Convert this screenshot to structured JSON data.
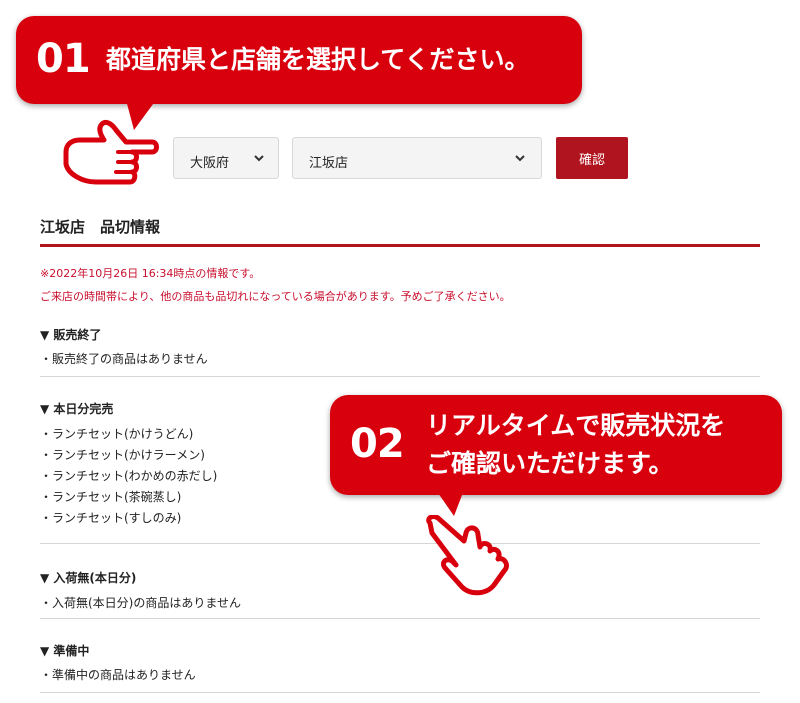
{
  "callout1": {
    "number": "01",
    "message": "都道府県と店舗を選択してください。"
  },
  "callout2": {
    "number": "02",
    "line1": "リアルタイムで販売状況を",
    "line2": "ご確認いただけます。"
  },
  "form": {
    "prefecture": "大阪府",
    "store": "江坂店",
    "confirm_label": "確認"
  },
  "page_title": "江坂店　品切情報",
  "notice": {
    "line1": "※2022年10月26日 16:34時点の情報です。",
    "line2": "ご来店の時間帯により、他の商品も品切れになっている場合があります。予めご了承ください。"
  },
  "sections": [
    {
      "heading": "▼ 販売終了",
      "items": [
        "・販売終了の商品はありません"
      ]
    },
    {
      "heading": "▼ 本日分完売",
      "items": [
        "・ランチセット(かけうどん)",
        "・ランチセット(かけラーメン)",
        "・ランチセット(わかめの赤だし)",
        "・ランチセット(茶碗蒸し)",
        "・ランチセット(すしのみ)"
      ]
    },
    {
      "heading": "▼ 入荷無(本日分)",
      "items": [
        "・入荷無(本日分)の商品はありません"
      ]
    },
    {
      "heading": "▼ 準備中",
      "items": [
        "・準備中の商品はありません"
      ]
    }
  ],
  "colors": {
    "accent": "#d9000d",
    "button": "#b0141e",
    "notice": "#c8102e"
  },
  "icons": [
    "pointing-hand-icon",
    "chevron-down-icon"
  ]
}
